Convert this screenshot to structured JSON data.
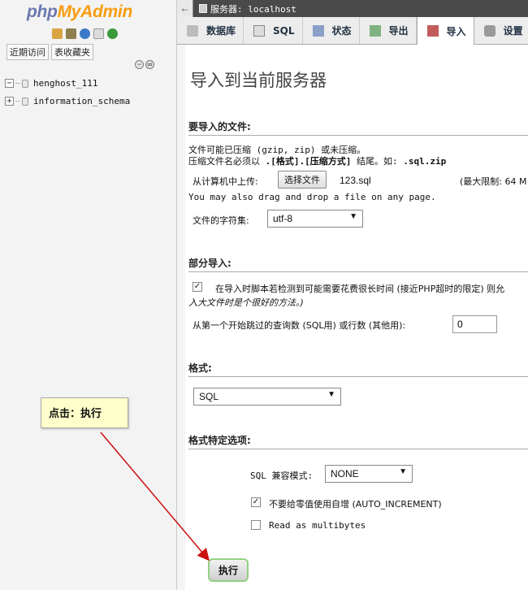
{
  "nav": {
    "logo_php": "php",
    "logo_myadmin": "MyAdmin",
    "links": [
      "近期访问",
      "表收藏夹"
    ],
    "databases": [
      "henghost_111",
      "information_schema"
    ]
  },
  "topbar": {
    "server_label": "服务器: localhost"
  },
  "tabs": [
    {
      "label": "数据库",
      "icon": "database-icon"
    },
    {
      "label": "SQL",
      "icon": "sql-icon"
    },
    {
      "label": "状态",
      "icon": "status-icon"
    },
    {
      "label": "导出",
      "icon": "export-icon"
    },
    {
      "label": "导入",
      "icon": "import-icon"
    },
    {
      "label": "设置",
      "icon": "settings-icon"
    }
  ],
  "page_title": "导入到当前服务器",
  "file_section": {
    "heading": "要导入的文件:",
    "desc1": "文件可能已压缩 (gzip, zip) 或未压缩。",
    "desc2_prefix": "压缩文件名必须以 ",
    "desc2_bold": ".[格式].[压缩方式]",
    "desc2_mid": " 结尾。如: ",
    "desc2_example": ".sql.zip",
    "upload_label": "从计算机中上传:",
    "choose_button": "选择文件",
    "file_name": "123.sql",
    "max_limit": "(最大限制: 64 M",
    "drag_hint": "You may also drag and drop a file on any page.",
    "charset_label": "文件的字符集:",
    "charset_value": "utf-8"
  },
  "partial_section": {
    "heading": "部分导入:",
    "interrupt_text": "在导入时脚本若检测到可能需要花费很长时间 (接近PHP超时的限定) 则允",
    "interrupt_note": "入大文件时是个很好的方法。)",
    "skip_label": "从第一个开始跳过的查询数 (SQL用) 或行数 (其他用):",
    "skip_value": "0"
  },
  "format_section": {
    "heading": "格式:",
    "format_value": "SQL"
  },
  "options_section": {
    "heading": "格式特定选项:",
    "compat_label": "SQL 兼容模式:",
    "compat_value": "NONE",
    "no_auto_value": "不要给零值使用自增 (AUTO_INCREMENT)",
    "multibytes": "Read as multibytes"
  },
  "go_button": "执行",
  "callout": "点击：执行",
  "colors": {
    "logo_blue": "#6c78af",
    "logo_orange": "#f89c0e",
    "annotation_red": "#cc1111",
    "callout_bg": "#ffffcc"
  }
}
